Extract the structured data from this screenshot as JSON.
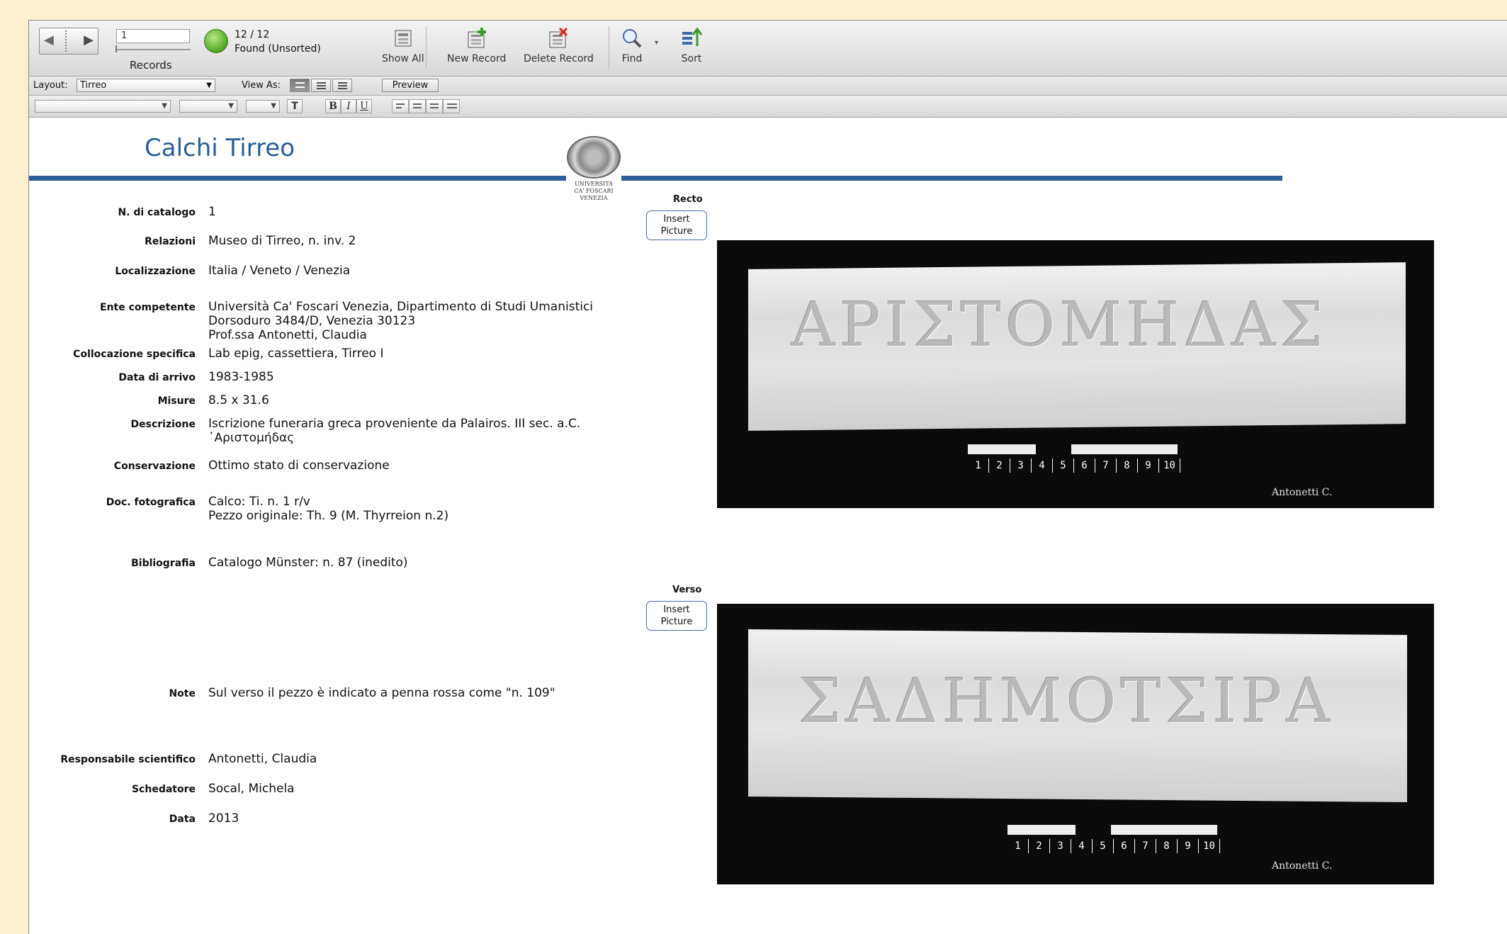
{
  "status": {
    "record_number": "1",
    "records_label": "Records",
    "found_count": "12 / 12",
    "found_status": "Found (Unsorted)",
    "buttons": {
      "show_all": "Show All",
      "new_record": "New Record",
      "delete_record": "Delete Record",
      "find": "Find",
      "sort": "Sort"
    },
    "found_color": "#4ea521"
  },
  "layout_bar": {
    "layout_label": "Layout:",
    "layout_value": "Tirreo",
    "view_as_label": "View As:",
    "preview": "Preview"
  },
  "header": {
    "title": "Calchi Tirreo",
    "logo_text": [
      "UNIVERSITÀ",
      "CA' FOSCARI",
      "VENEZIA"
    ],
    "accent": "#2f5f9b"
  },
  "fields": [
    {
      "label": "N. di catalogo",
      "value": "1"
    },
    {
      "label": "Relazioni",
      "value": "Museo di Tirreo, n. inv. 2"
    },
    {
      "label": "Localizzazione",
      "value": "Italia / Veneto / Venezia"
    },
    {
      "label": "Ente competente",
      "value": "Università Ca' Foscari Venezia, Dipartimento di Studi Umanistici\nDorsoduro 3484/D, Venezia 30123\nProf.ssa Antonetti, Claudia"
    },
    {
      "label": "Collocazione specifica",
      "value": "Lab epig, cassettiera, Tirreo I"
    },
    {
      "label": "Data di arrivo",
      "value": "1983-1985"
    },
    {
      "label": "Misure",
      "value": "8.5 x 31.6"
    },
    {
      "label": "Descrizione",
      "value": "Iscrizione funeraria greca proveniente da Palairos. III sec. a.C.\n᾽Αριστομήδας"
    },
    {
      "label": "Conservazione",
      "value": "Ottimo stato di conservazione"
    },
    {
      "label": "Doc. fotografica",
      "value": "Calco: Ti. n. 1 r/v\nPezzo originale: Th. 9 (M. Thyrreion n.2)"
    },
    {
      "label": "Bibliografia",
      "value": "Catalogo Münster: n. 87 (inedito)"
    },
    {
      "label": "Note",
      "value": "Sul verso il pezzo è indicato a penna rossa come \"n. 109\""
    },
    {
      "label": "Responsabile scientifico",
      "value": "Antonetti, Claudia"
    },
    {
      "label": "Schedatore",
      "value": "Socal, Michela"
    },
    {
      "label": "Data",
      "value": "2013"
    }
  ],
  "images": {
    "recto_label": "Recto",
    "verso_label": "Verso",
    "insert_label": "Insert\nPicture",
    "recto_inscription": "ΑΡΙΣΤΟΜΗΔΑΣ",
    "verso_inscription": "ΣΑΔΗΜΟΤΣΙΡΑ",
    "credit": "Antonetti C.",
    "scale_ticks": [
      "1",
      "2",
      "3",
      "4",
      "5",
      "6",
      "7",
      "8",
      "9",
      "10"
    ]
  }
}
